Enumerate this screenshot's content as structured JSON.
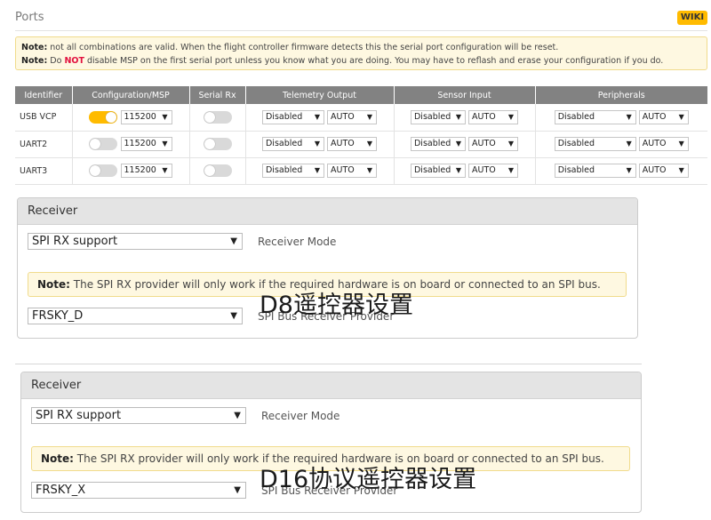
{
  "header": {
    "title": "Ports",
    "wiki_label": "WIKI"
  },
  "notes": {
    "line1_prefix": "Note:",
    "line1_text": " not all combinations are valid. When the flight controller firmware detects this the serial port configuration will be reset.",
    "line2_prefix": "Note:",
    "line2_pre": " Do ",
    "line2_red": "NOT",
    "line2_post": " disable MSP on the first serial port unless you know what you are doing. You may have to reflash and erase your configuration if you do."
  },
  "ports_table": {
    "headers": [
      "Identifier",
      "Configuration/MSP",
      "Serial Rx",
      "Telemetry Output",
      "Sensor Input",
      "Peripherals"
    ],
    "rows": [
      {
        "id": "USB VCP",
        "msp_on": true,
        "baud": "115200",
        "telemetry": "Disabled",
        "telemetry_rate": "AUTO",
        "sensor": "Disabled",
        "sensor_rate": "AUTO",
        "peripheral": "Disabled",
        "peripheral_rate": "AUTO"
      },
      {
        "id": "UART2",
        "msp_on": false,
        "baud": "115200",
        "telemetry": "Disabled",
        "telemetry_rate": "AUTO",
        "sensor": "Disabled",
        "sensor_rate": "AUTO",
        "peripheral": "Disabled",
        "peripheral_rate": "AUTO"
      },
      {
        "id": "UART3",
        "msp_on": false,
        "baud": "115200",
        "telemetry": "Disabled",
        "telemetry_rate": "AUTO",
        "sensor": "Disabled",
        "sensor_rate": "AUTO",
        "peripheral": "Disabled",
        "peripheral_rate": "AUTO"
      }
    ]
  },
  "receiver1": {
    "title": "Receiver",
    "mode_value": "SPI RX support",
    "mode_label": "Receiver Mode",
    "note_prefix": "Note:",
    "note_text": " The SPI RX provider will only work if the required hardware is on board or connected to an SPI bus.",
    "provider_value": "FRSKY_D",
    "provider_label": "SPI Bus Receiver Provider",
    "overlay": "D8遥控器设置"
  },
  "receiver2": {
    "title": "Receiver",
    "mode_value": "SPI RX support",
    "mode_label": "Receiver Mode",
    "note_prefix": "Note:",
    "note_text": " The SPI RX provider will only work if the required hardware is on board or connected to an SPI bus.",
    "provider_value": "FRSKY_X",
    "provider_label": "SPI Bus Receiver Provider",
    "overlay": "D16协议遥控器设置"
  },
  "colors": {
    "accent": "#ffbb00",
    "header_bg": "#828282",
    "note_bg": "#fef8e1",
    "note_red": "#e2123f"
  }
}
